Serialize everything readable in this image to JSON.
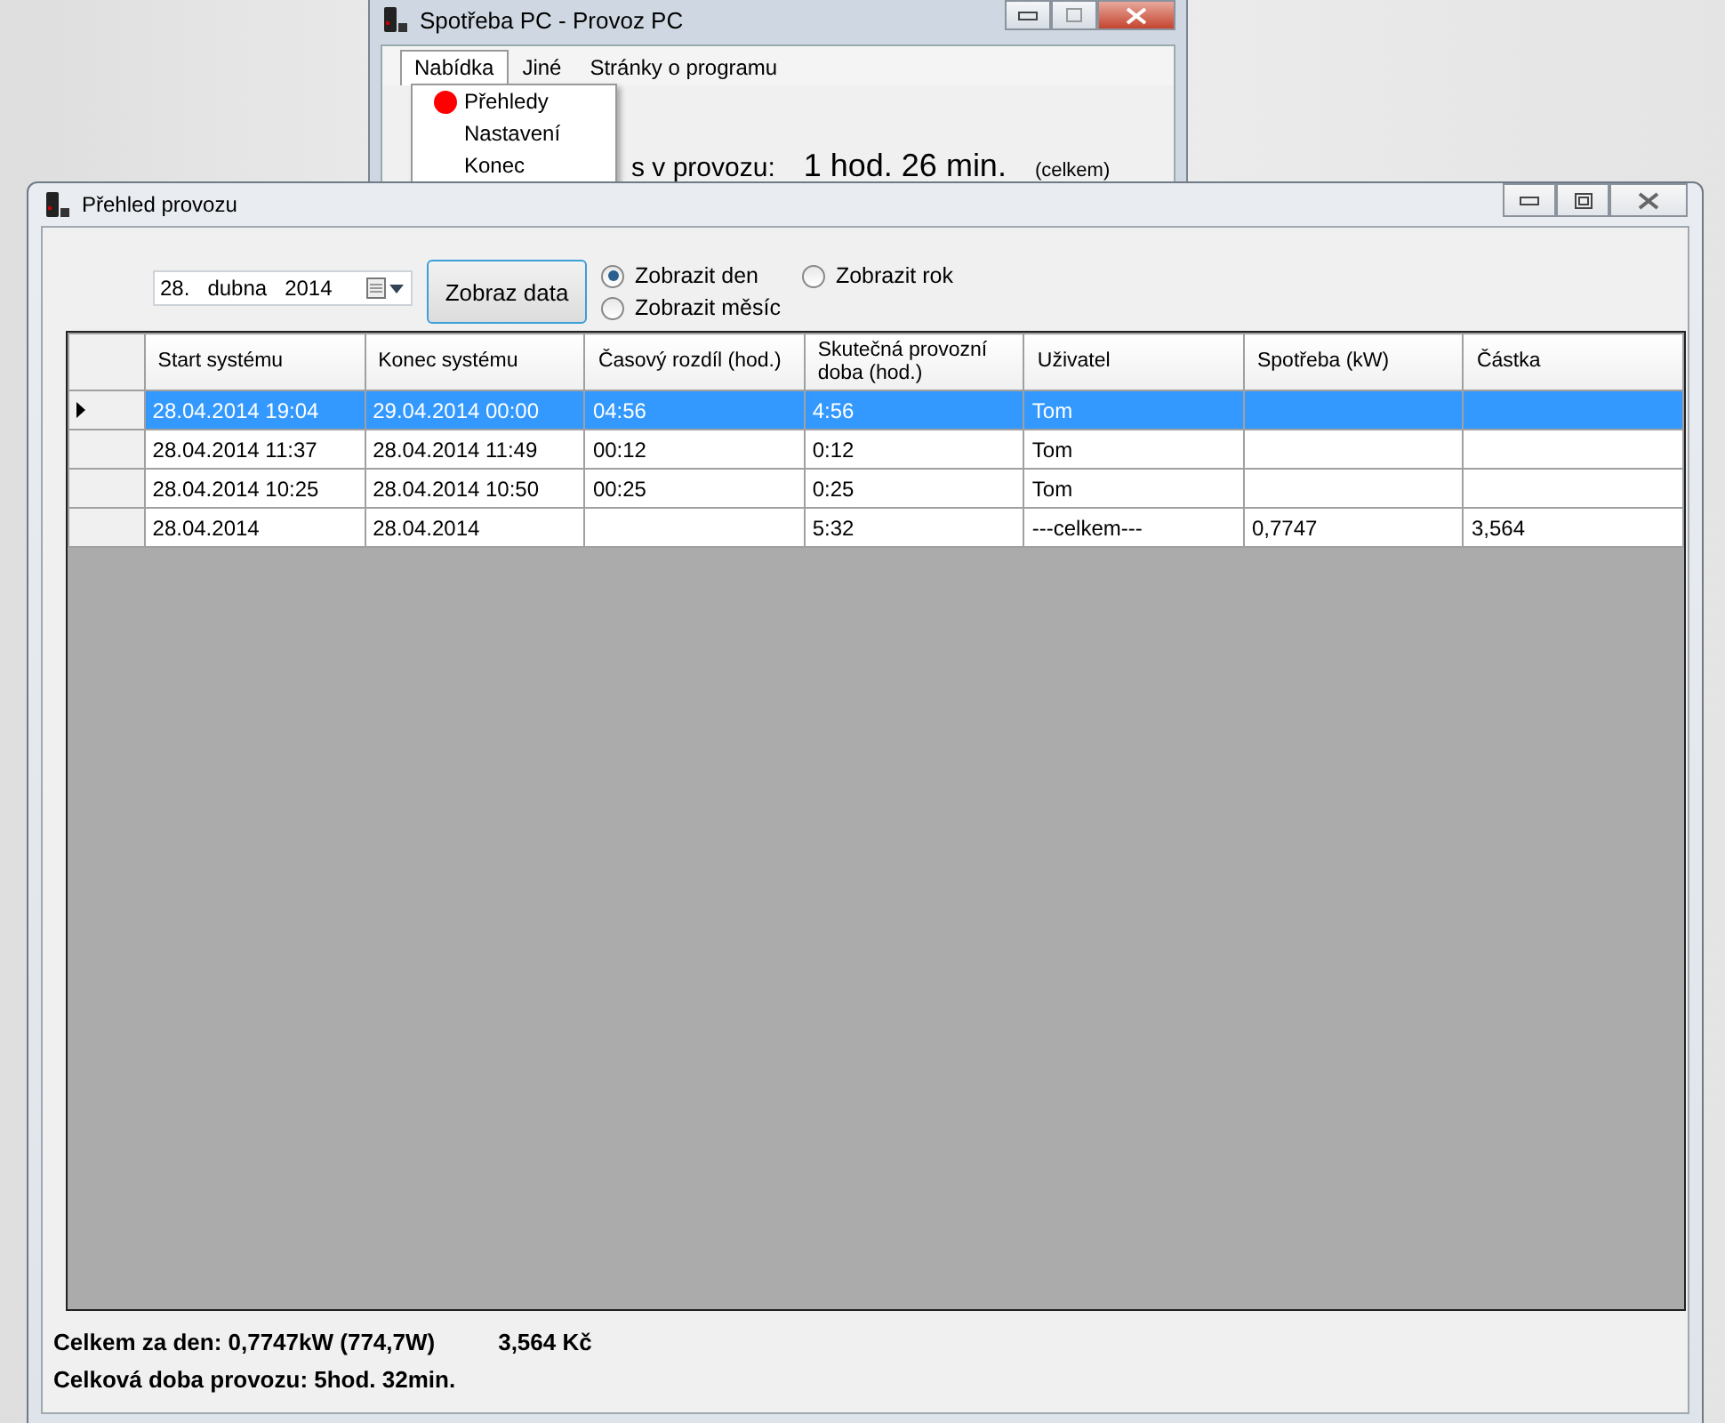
{
  "background_window": {
    "title": "Spotřeba PC - Provoz PC",
    "menu": [
      {
        "label": "Nabídka",
        "selected": true
      },
      {
        "label": "Jiné",
        "selected": false
      },
      {
        "label": "Stránky o programu",
        "selected": false
      }
    ],
    "dropdown": [
      {
        "label": "Přehledy",
        "checked": true
      },
      {
        "label": "Nastavení",
        "checked": false
      },
      {
        "label": "Konec",
        "checked": false
      }
    ],
    "uptime_label": "s v provozu:",
    "uptime_value": "1 hod. 26 min.",
    "uptime_note": "(celkem)"
  },
  "window": {
    "title": "Přehled provozu"
  },
  "date_picker": {
    "day": "28.",
    "month": "dubna",
    "year": "2014"
  },
  "show_button": "Zobraz data",
  "radios": [
    {
      "label": "Zobrazit den",
      "selected": true
    },
    {
      "label": "Zobrazit měsíc",
      "selected": false
    },
    {
      "label": "Zobrazit rok",
      "selected": false
    }
  ],
  "table": {
    "columns": [
      "Start systému",
      "Konec systému",
      "Časový rozdíl (hod.)",
      "Skutečná provozní doba (hod.)",
      "Uživatel",
      "Spotřeba (kW)",
      "Částka"
    ],
    "rows": [
      {
        "selected": true,
        "cells": [
          "28.04.2014 19:04",
          "29.04.2014 00:00",
          "04:56",
          "4:56",
          "Tom",
          "",
          ""
        ]
      },
      {
        "selected": false,
        "cells": [
          "28.04.2014 11:37",
          "28.04.2014 11:49",
          "00:12",
          "0:12",
          "Tom",
          "",
          ""
        ]
      },
      {
        "selected": false,
        "cells": [
          "28.04.2014 10:25",
          "28.04.2014 10:50",
          "00:25",
          "0:25",
          "Tom",
          "",
          ""
        ]
      },
      {
        "selected": false,
        "cells": [
          "28.04.2014",
          "28.04.2014",
          "",
          "5:32",
          "---celkem---",
          "0,7747",
          "3,564"
        ]
      }
    ]
  },
  "summary": {
    "day_total": "Celkem za den: 0,7747kW  (774,7W)",
    "day_cost": "3,564 Kč",
    "uptime": "Celková doba provozu: 5hod. 32min."
  }
}
